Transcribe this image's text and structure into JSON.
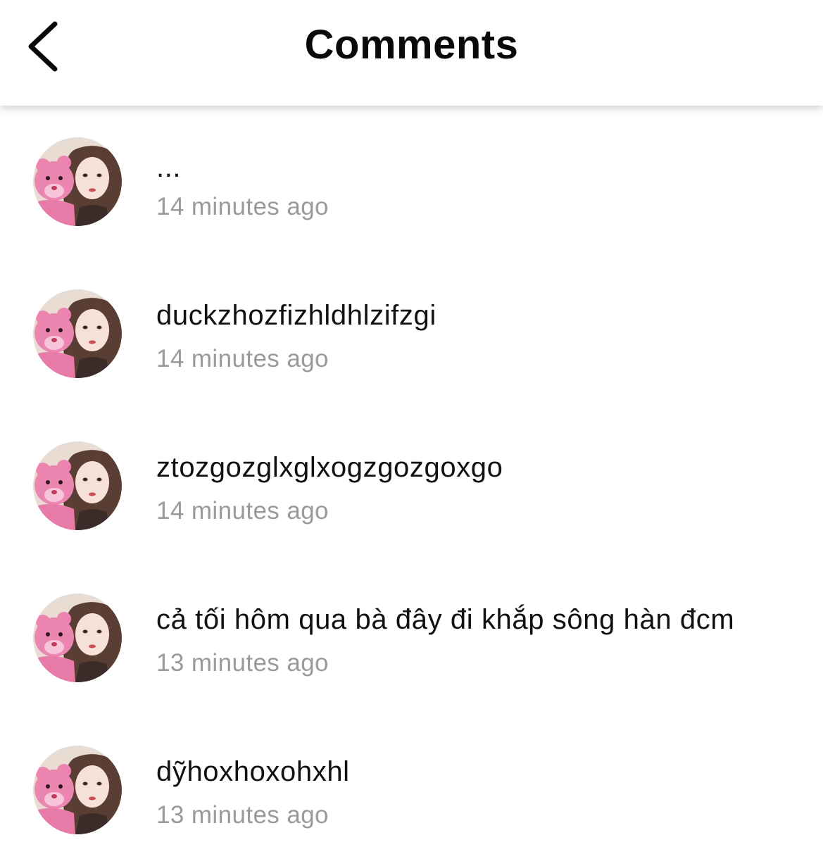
{
  "header": {
    "title": "Comments",
    "back_icon": "chevron-left-icon"
  },
  "comments": [
    {
      "text": "...",
      "time": "14 minutes ago",
      "avatar_icon": "user-avatar"
    },
    {
      "text": "duckzhozfizhldhlzifzgi",
      "time": "14 minutes ago",
      "avatar_icon": "user-avatar"
    },
    {
      "text": "ztozgozglxglxogzgozgoxgo",
      "time": "14 minutes ago",
      "avatar_icon": "user-avatar"
    },
    {
      "text": "cả tối hôm qua bà đây đi khắp sông hàn đcm",
      "time": "13 minutes ago",
      "avatar_icon": "user-avatar"
    },
    {
      "text": "dỹhoxhoxohxhl",
      "time": "13 minutes ago",
      "avatar_icon": "user-avatar"
    }
  ],
  "colors": {
    "text": "#111111",
    "timestamp": "#9a9a9a",
    "background": "#ffffff"
  }
}
